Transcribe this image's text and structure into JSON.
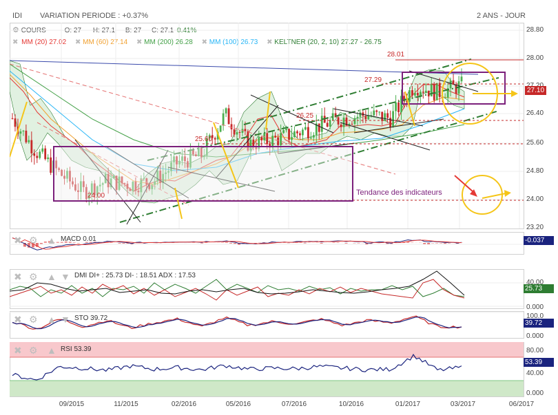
{
  "header": {
    "symbol": "IDI",
    "variation": "VARIATION PERIODE : +0.37%",
    "period": "2 ANS - JOUR"
  },
  "ohlc": {
    "cours_label": "COURS",
    "open_label": "O:",
    "open": "27",
    "high_label": "H:",
    "high": "27.1",
    "low_label": "B:",
    "low": "27",
    "close_label": "C:",
    "close": "27.1",
    "change": "0.41%"
  },
  "moving_averages": [
    {
      "label": "MM (20)",
      "value": "27.02",
      "color": "#e53935"
    },
    {
      "label": "MM (60)",
      "value": "27.14",
      "color": "#f0a030"
    },
    {
      "label": "MM (200)",
      "value": "26.28",
      "color": "#43a047"
    },
    {
      "label": "MM (100)",
      "value": "26.73",
      "color": "#29b6f6"
    },
    {
      "label": "KELTNER (20, 2, 10)",
      "value": "27.27 - 26.75",
      "color": "#2e7d32"
    }
  ],
  "price_axis": {
    "ticks": [
      "28.80",
      "28.00",
      "27.20",
      "26.40",
      "25.60",
      "24.80",
      "24.00",
      "23.20"
    ],
    "last_price": "27.10"
  },
  "annotations": {
    "level_28_01": "28.01",
    "level_27_29": "27.29",
    "level_26_25": "26.25",
    "level_25_60": "25.60",
    "level_24_00": "24.00",
    "trend_text": "Tendance des indicateurs"
  },
  "x_axis": [
    "09/2015",
    "11/2015",
    "02/2016",
    "05/2016",
    "07/2016",
    "10/2016",
    "01/2017",
    "03/2017",
    "06/2017"
  ],
  "indicators": {
    "macd": {
      "label": "MACD",
      "value": "0.01",
      "last": "-0.037"
    },
    "dmi": {
      "label": "DMI",
      "text": "DI+ : 25.73 DI- : 18.51 ADX : 17.53",
      "last": "25.73",
      "ticks": [
        "40.00",
        "0.000"
      ]
    },
    "sto": {
      "label": "STO",
      "value": "39.72",
      "last": "39.72",
      "ticks": [
        "100.0",
        "0.000"
      ]
    },
    "rsi": {
      "label": "RSI",
      "value": "53.39",
      "last": "53.39",
      "ticks": [
        "80.00",
        "40.00",
        "0.000"
      ]
    }
  },
  "colors": {
    "bull": "#4caf50",
    "bear": "#c62828",
    "annotation_purple": "#7b1f7b",
    "channel_green": "#2e7d32",
    "highlight_yellow": "#f5c518",
    "macd_value_bg": "#1a237e",
    "dmi_value_bg": "#2e7d32",
    "sto_value_bg": "#1a237e",
    "rsi_value_bg": "#1a237e",
    "price_tag_bg": "#c62828"
  },
  "chart_data": {
    "type": "candlestick",
    "x": [
      "08/2015",
      "09/2015",
      "10/2015",
      "11/2015",
      "12/2015",
      "01/2016",
      "02/2016",
      "03/2016",
      "04/2016",
      "05/2016",
      "06/2016",
      "07/2016",
      "08/2016",
      "09/2016",
      "10/2016",
      "11/2016",
      "12/2016",
      "01/2017",
      "02/2017",
      "03/2017"
    ],
    "close": [
      26.2,
      25.3,
      24.7,
      24.2,
      24.5,
      24.4,
      24.5,
      25.0,
      25.2,
      26.3,
      25.5,
      25.6,
      25.8,
      26.0,
      26.2,
      26.3,
      26.2,
      27.1,
      26.9,
      27.1
    ],
    "ylim": [
      23.2,
      28.8
    ],
    "series": [
      {
        "name": "MACD",
        "values": [
          0.2,
          -0.25,
          -0.1,
          -0.05,
          0.05,
          0.0,
          0.02,
          0.05,
          0.04,
          0.08,
          -0.05,
          0.02,
          0.05,
          0.04,
          0.06,
          0.02,
          0.01,
          0.12,
          0.02,
          0.01
        ]
      },
      {
        "name": "STO",
        "values": [
          60,
          30,
          70,
          40,
          65,
          35,
          55,
          70,
          40,
          75,
          45,
          60,
          50,
          70,
          45,
          65,
          55,
          80,
          40,
          39.72
        ]
      },
      {
        "name": "RSI",
        "values": [
          40,
          30,
          55,
          52,
          48,
          56,
          50,
          53,
          49,
          57,
          50,
          52,
          51,
          55,
          52,
          49,
          50,
          75,
          48,
          53.39
        ]
      }
    ]
  }
}
